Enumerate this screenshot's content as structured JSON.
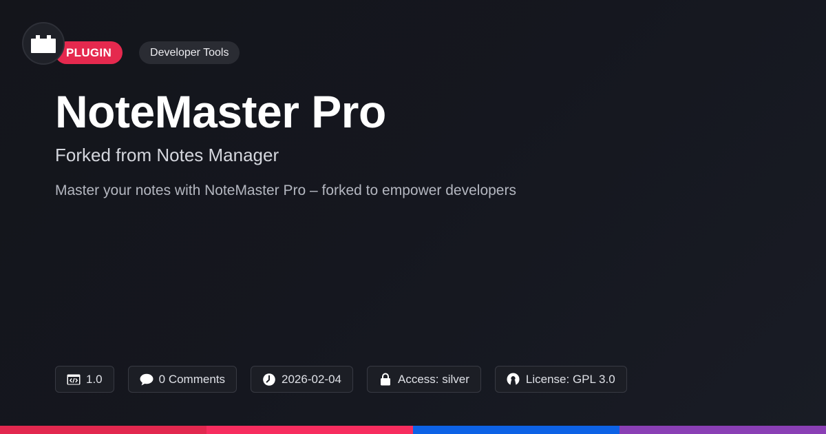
{
  "header": {
    "logo_icon": "plugin-block-icon",
    "type_badge": "PLUGIN",
    "category_badge": "Developer Tools"
  },
  "main": {
    "title": "NoteMaster Pro",
    "subtitle": "Forked from Notes Manager",
    "description": "Master your notes with NoteMaster Pro – forked to empower developers"
  },
  "meta": {
    "version": {
      "icon": "code-window-icon",
      "label": "1.0"
    },
    "comments": {
      "icon": "comment-bubble-icon",
      "label": "0 Comments"
    },
    "date": {
      "icon": "clock-icon",
      "label": "2026-02-04"
    },
    "access": {
      "icon": "lock-icon",
      "label": "Access: silver"
    },
    "license": {
      "icon": "open-source-icon",
      "label": "License: GPL 3.0"
    }
  },
  "colors": {
    "accent": "#e5294e",
    "background": "#15171f",
    "bar_segments": [
      "#e2284f",
      "#f72d5f",
      "#0d62e6",
      "#8a3fb5"
    ]
  }
}
